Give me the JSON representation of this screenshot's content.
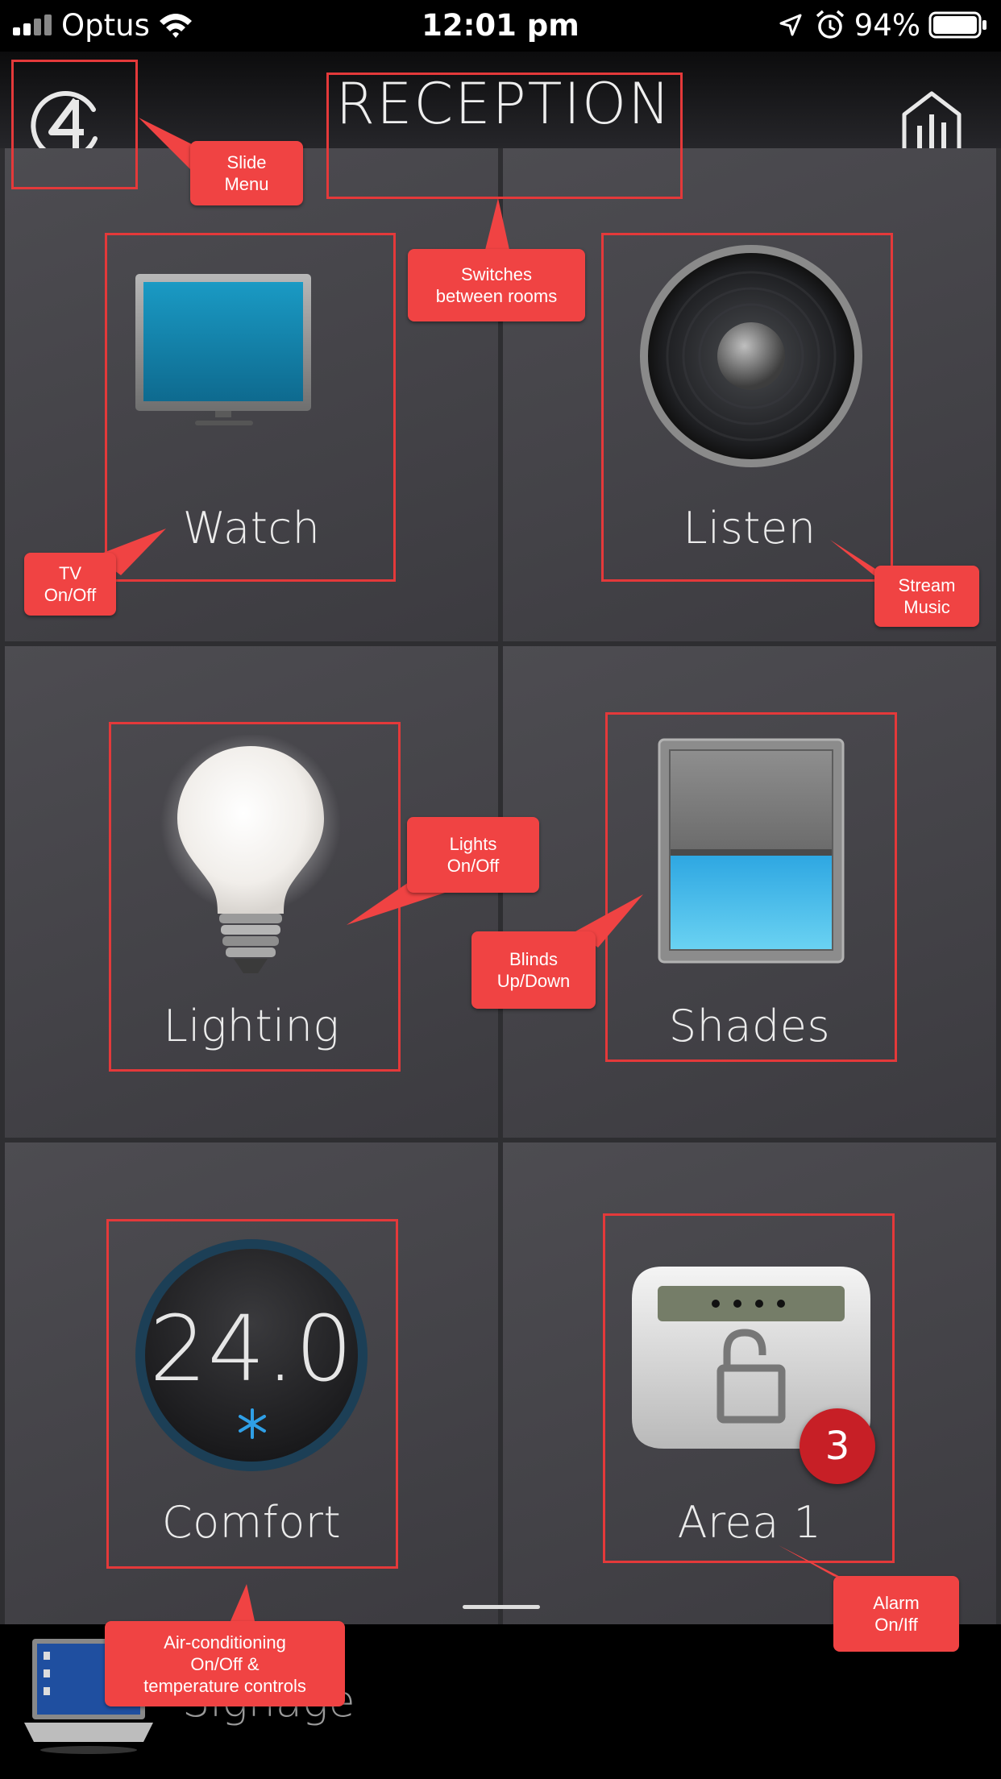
{
  "status_bar": {
    "carrier": "Optus",
    "time": "12:01 pm",
    "battery": "94%",
    "icons": [
      "signal-icon",
      "wifi-icon",
      "location-icon",
      "alarm-clock-icon",
      "battery-icon"
    ]
  },
  "header": {
    "room": "RECEPTION",
    "menu_icon": "c4-logo-icon",
    "stats_icon": "bar-chart-house-icon"
  },
  "tiles": [
    {
      "label": "Watch",
      "icon": "tv-icon"
    },
    {
      "label": "Listen",
      "icon": "speaker-icon"
    },
    {
      "label": "Lighting",
      "icon": "light-bulb-icon"
    },
    {
      "label": "Shades",
      "icon": "shades-icon"
    },
    {
      "label": "Comfort",
      "icon": "thermostat-icon",
      "temperature": "24.0",
      "mode_icon": "snowflake-icon"
    },
    {
      "label": "Area 1",
      "icon": "alarm-keypad-icon",
      "badge": "3"
    }
  ],
  "bottom_bar": {
    "label": "Signage",
    "icon": "laptop-icon"
  },
  "callouts": {
    "slide_menu": "Slide\nMenu",
    "switch_rooms": "Switches\nbetween rooms",
    "tv": "TV\nOn/Off",
    "stream": "Stream\nMusic",
    "lights": "Lights\nOn/Off",
    "blinds": "Blinds\nUp/Down",
    "aircon": "Air-conditioning\nOn/Off &\ntemperature controls",
    "alarm": "Alarm\nOn/Iff"
  },
  "colors": {
    "annotation": "#F04343",
    "annotation_border": "#E4393A",
    "tile": "#46454A",
    "badge": "#C71F26",
    "screen_blue": "#1A8DB5",
    "shade_blue": "#3BB5E6"
  }
}
